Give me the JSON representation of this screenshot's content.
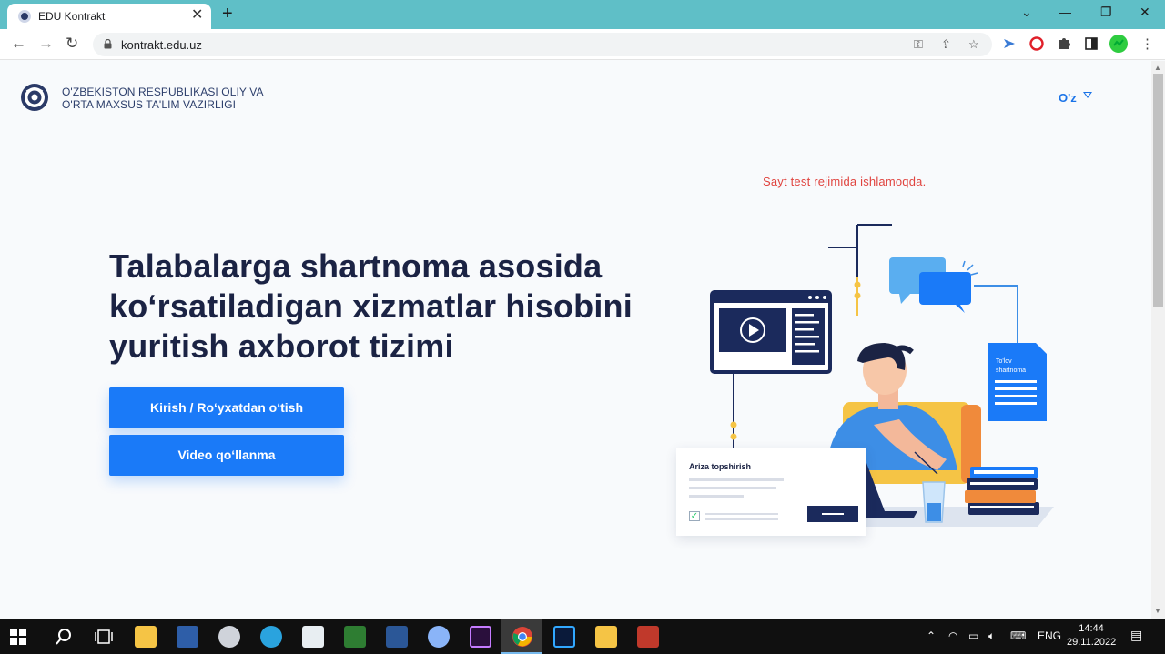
{
  "browser": {
    "tab_title": "EDU Kontrakt",
    "url": "kontrakt.edu.uz"
  },
  "header": {
    "ministry_line1": "O'ZBEKISTON RESPUBLIKASI OLIY VA",
    "ministry_line2": "O'RTA MAXSUS TA'LIM VAZIRLIGI",
    "language": "O'z"
  },
  "hero": {
    "headline_line1": "Talabalarga shartnoma asosida",
    "headline_line2": "koʻrsatiladigan xizmatlar hisobini",
    "headline_line3": "yuritish axborot tizimi",
    "login_button": "Kirish / Roʻyxatdan oʻtish",
    "video_button": "Video qoʻllanma",
    "test_notice": "Sayt test rejimida ishlamoqda."
  },
  "illustration": {
    "card_title": "Ariza topshirish",
    "document_line1": "To'lov",
    "document_line2": "shartnoma"
  },
  "colors": {
    "accent": "#1a7af8",
    "headline": "#1b2344",
    "notice": "#e0443f",
    "tabbar": "#5fbfc7"
  },
  "taskbar": {
    "language": "ENG",
    "time": "14:44",
    "date": "29.11.2022"
  }
}
